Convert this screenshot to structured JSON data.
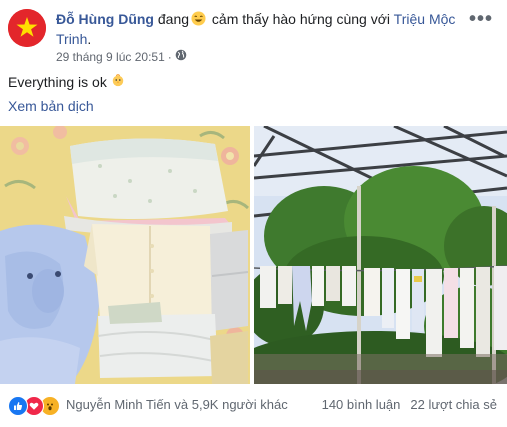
{
  "post": {
    "author": "Đỗ Hùng Dũng",
    "feeling_prefix": "đang",
    "feeling_text": "cảm thấy hào hứng cùng với",
    "tagged": "Triệu Mộc Trinh",
    "tagged_suffix": ".",
    "timestamp": "29 tháng 9 lúc 20:51",
    "separator": "·",
    "privacy_icon": "globe-icon",
    "menu_label": "•••",
    "body": "Everything is ok",
    "translate_label": "Xem bản dịch"
  },
  "photos": [
    {
      "icon": "baby-clothes-pile-photo"
    },
    {
      "icon": "laundry-drying-photo"
    }
  ],
  "footer": {
    "reactions": [
      "like-icon",
      "love-icon",
      "wow-icon"
    ],
    "reactors": "Nguyễn Minh Tiến và 5,9K người khác",
    "comments": "140 bình luận",
    "shares": "22 lượt chia sẻ"
  },
  "colors": {
    "link": "#385898",
    "avatar": "#e3262b",
    "like": "#1877f2",
    "love": "#f0284a"
  }
}
